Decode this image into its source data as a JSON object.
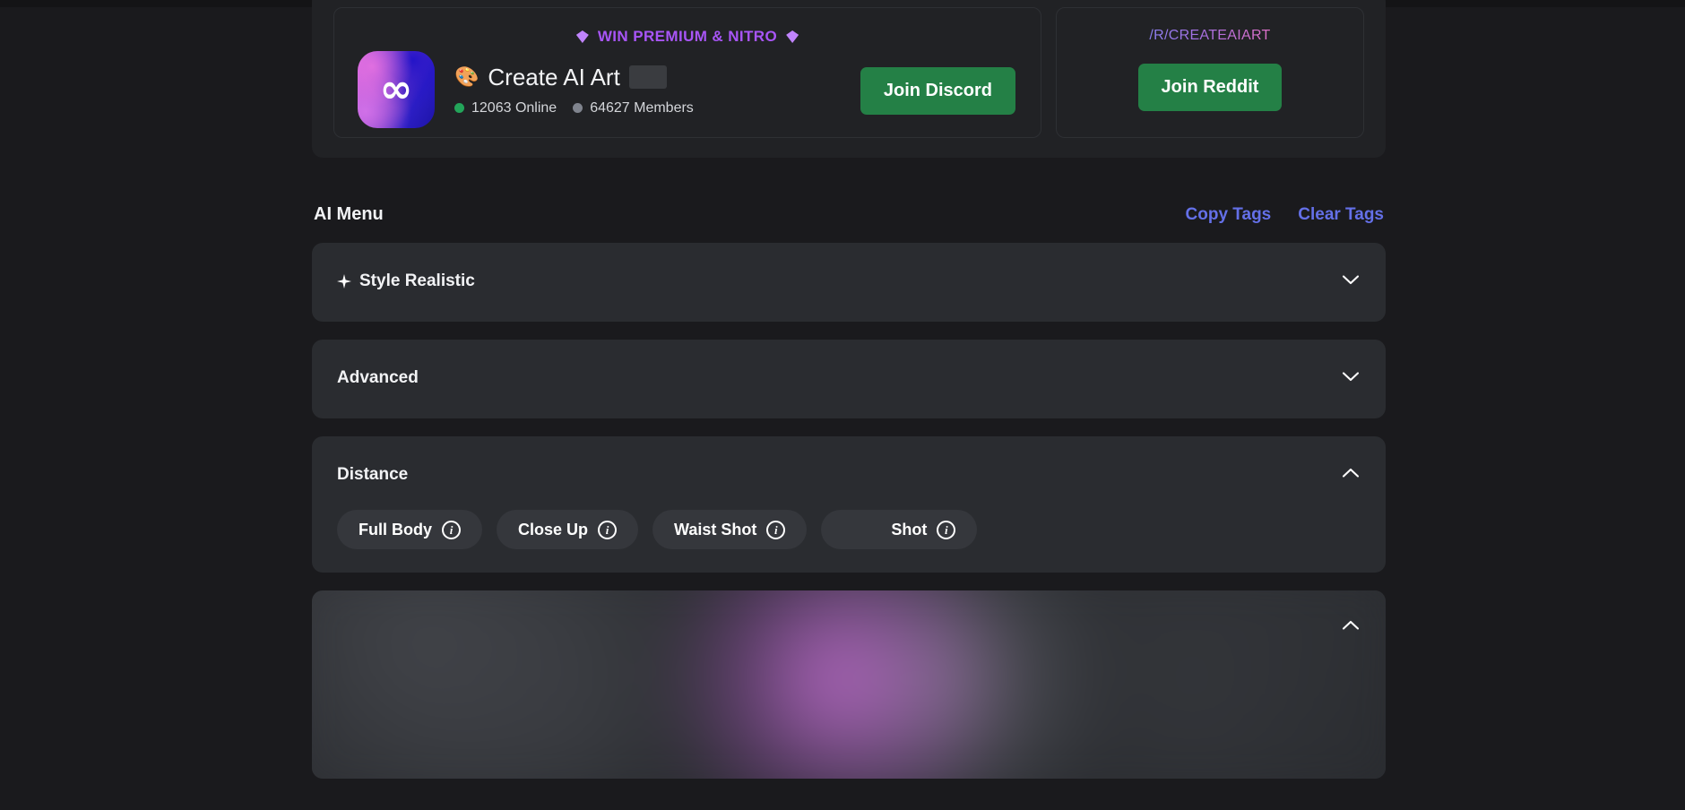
{
  "promo": {
    "discord": {
      "banner_text": "WIN PREMIUM & NITRO",
      "gem_icon_left": "gem-icon",
      "gem_icon_right": "gem-icon",
      "avatar_icon": "infinity-logo",
      "avatar_glyph": "∞",
      "palette_emoji": "🎨",
      "server_name": "Create AI Art",
      "online_count": "12063 Online",
      "members_count": "64627 Members",
      "join_label": "Join Discord"
    },
    "reddit": {
      "subreddit": "/R/CREATEAIART",
      "join_label": "Join Reddit"
    }
  },
  "menu": {
    "title": "AI Menu",
    "copy_tags_label": "Copy Tags",
    "clear_tags_label": "Clear Tags"
  },
  "panels": {
    "style": {
      "label": "Style Realistic",
      "sparkle_icon": "sparkle-icon",
      "chevron": "chevron-down-icon"
    },
    "advanced": {
      "label": "Advanced",
      "chevron": "chevron-down-icon"
    },
    "distance": {
      "label": "Distance",
      "chevron": "chevron-up-icon",
      "chips": [
        {
          "label": "Full Body",
          "info": "i"
        },
        {
          "label": "Close Up",
          "info": "i"
        },
        {
          "label": "Waist Shot",
          "info": "i"
        },
        {
          "label": "Shot",
          "info": "i"
        }
      ]
    },
    "blurred": {
      "chevron": "chevron-up-icon"
    }
  },
  "colors": {
    "background": "#1a1a1d",
    "panel": "#2a2c30",
    "accent_link": "#6470e8",
    "accent_purple": "#a855f7",
    "green_button": "#248046",
    "online_green": "#23a55a",
    "members_gray": "#80848e"
  }
}
